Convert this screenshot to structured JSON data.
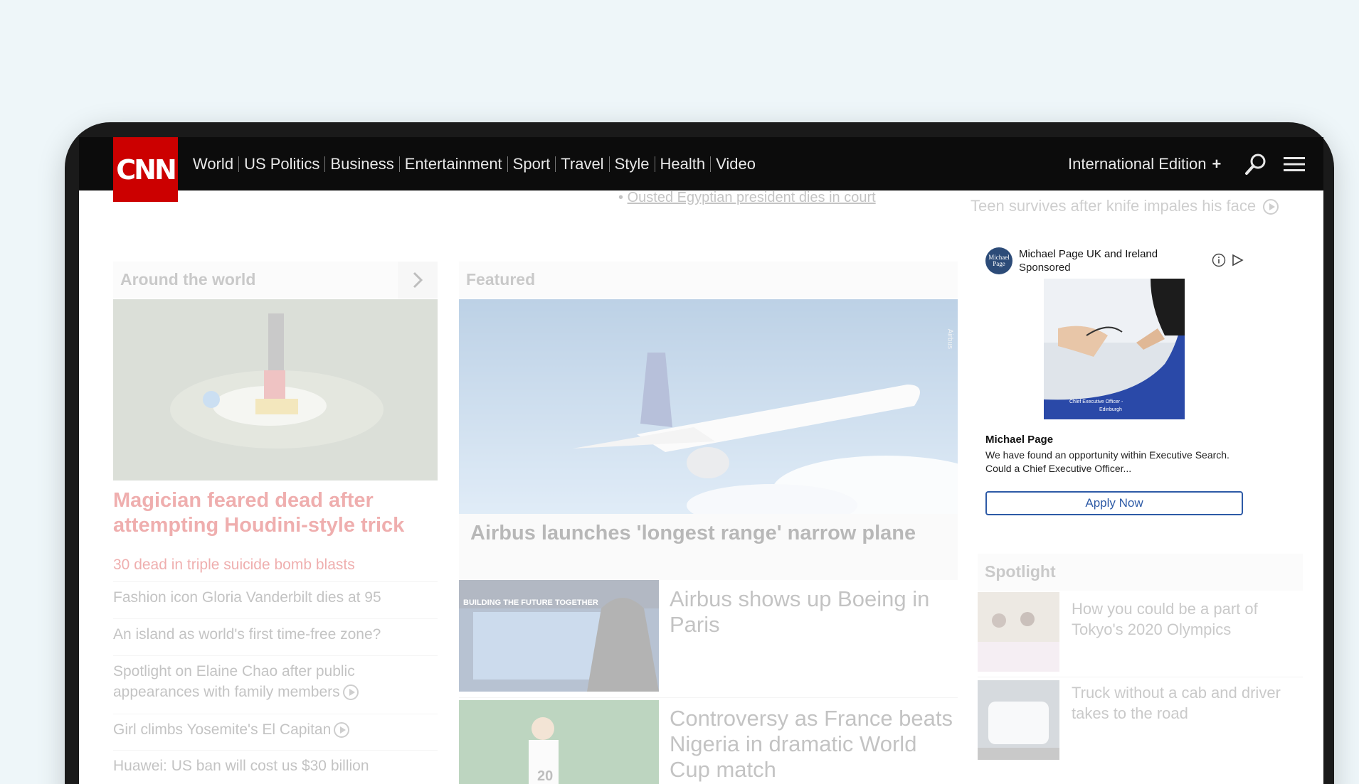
{
  "nav": {
    "logo": "CNN",
    "links": [
      "World",
      "US Politics",
      "Business",
      "Entertainment",
      "Sport",
      "Travel",
      "Style",
      "Health",
      "Video"
    ],
    "edition": "International Edition",
    "edition_plus": "+",
    "icons": [
      "search-icon",
      "menu-icon"
    ]
  },
  "ticker": {
    "bullet": "•",
    "headline": "Ousted Egyptian president dies in court",
    "right_headline": "Teen survives after knife impales his face"
  },
  "around_world": {
    "header": "Around the world",
    "lead_headline": "Magician feared dead after attempting Houdini-style trick",
    "items": [
      "30 dead in triple suicide bomb blasts",
      "Fashion icon Gloria Vanderbilt dies at 95",
      "An island as world's first time-free zone?",
      "Spotlight on Elaine Chao after public appearances with family members",
      "Girl climbs Yosemite's El Capitan",
      "Huawei: US ban will cost us $30 billion"
    ]
  },
  "featured": {
    "header": "Featured",
    "main_caption": "Airbus launches 'longest range' narrow plane",
    "image_credit": "Airbus",
    "thumb_banner": "BUILDING THE FUTURE TOGETHER",
    "jersey_number": "20",
    "stories": [
      "Airbus shows up Boeing in Paris",
      "Controversy as France beats Nigeria in dramatic World Cup match"
    ]
  },
  "ad": {
    "avatar_text": "Michael Page",
    "advertiser": "Michael Page UK and Ireland",
    "sponsored": "Sponsored",
    "image_caption_1": "Chief Executive Officer -",
    "image_caption_2": "Edinburgh",
    "title": "Michael Page",
    "description": "We have found an opportunity within Executive Search. Could a Chief Executive Officer...",
    "cta": "Apply Now"
  },
  "spotlight": {
    "header": "Spotlight",
    "items": [
      "How you could be a part of Tokyo's 2020 Olympics",
      "Truck without a cab and driver takes to the road"
    ]
  },
  "colors": {
    "cnn_red": "#cc0000",
    "nav_bg": "#0c0c0c",
    "ad_blue": "#2d5aa6",
    "page_bg": "#eef6f9"
  }
}
